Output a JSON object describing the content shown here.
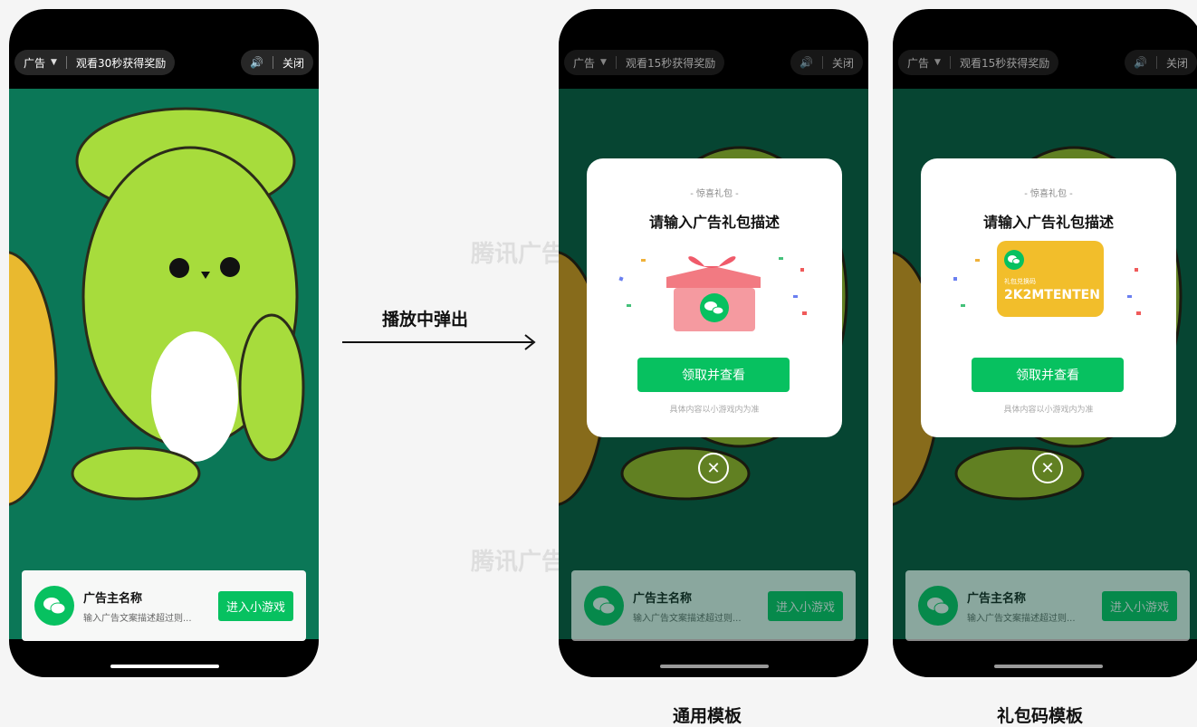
{
  "arrow_label": "播放中弹出",
  "captions": {
    "general": "通用模板",
    "code": "礼包码模板"
  },
  "watermark": "腾讯广告 营销学堂",
  "phone1": {
    "ad_label": "广告",
    "reward_text": "观看30秒获得奖励",
    "close": "关闭"
  },
  "phone2": {
    "ad_label": "广告",
    "reward_text": "观看15秒获得奖励",
    "close": "关闭",
    "modal": {
      "kicker": "- 惊喜礼包 -",
      "title": "请输入广告礼包描述",
      "button": "领取并查看",
      "footnote": "具体内容以小游戏内为准"
    }
  },
  "phone3": {
    "ad_label": "广告",
    "reward_text": "观看15秒获得奖励",
    "close": "关闭",
    "modal": {
      "kicker": "- 惊喜礼包 -",
      "title": "请输入广告礼包描述",
      "code_label": "礼包兑换码",
      "code": "2K2MTENTEN",
      "button": "领取并查看",
      "footnote": "具体内容以小游戏内为准"
    }
  },
  "adcard": {
    "advertiser": "广告主名称",
    "description": "输入广告文案描述超过则...",
    "enter_button": "进入小游戏"
  },
  "colors": {
    "brand_green": "#07c160",
    "screen_bg": "#0b7757",
    "gift_pink": "#f59aa0",
    "code_yellow": "#f2be2b",
    "mascot_green": "#a7dc3c"
  }
}
